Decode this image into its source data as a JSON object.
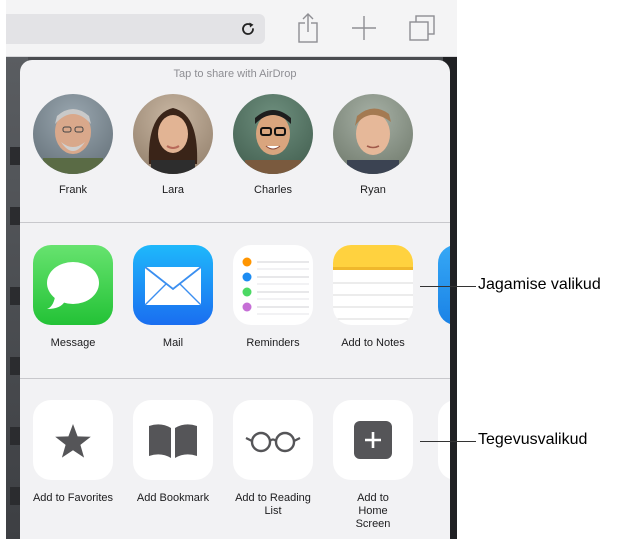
{
  "airdrop": {
    "hint": "Tap to share with AirDrop",
    "people": [
      {
        "name": "Frank"
      },
      {
        "name": "Lara"
      },
      {
        "name": "Charles"
      },
      {
        "name": "Ryan"
      }
    ]
  },
  "share_apps": [
    {
      "label": "Message",
      "icon": "message-bubble-icon",
      "color": "#4cd964"
    },
    {
      "label": "Mail",
      "icon": "mail-envelope-icon",
      "color": "#1e8af5"
    },
    {
      "label": "Reminders",
      "icon": "reminders-list-icon",
      "color": "#ffffff"
    },
    {
      "label": "Add to Notes",
      "icon": "notes-icon",
      "color": "#ffd94a"
    }
  ],
  "actions": [
    {
      "label": "Add to Favorites",
      "icon": "star-icon"
    },
    {
      "label": "Add Bookmark",
      "icon": "book-icon"
    },
    {
      "label": "Add to Reading List",
      "icon": "glasses-icon"
    },
    {
      "label": "Add to Home Screen",
      "icon": "plus-square-icon"
    }
  ],
  "callouts": {
    "share_options": "Jagamise valikud",
    "action_options": "Tegevusvalikud"
  },
  "toolbar": {
    "icons": [
      "reload-icon",
      "share-icon",
      "add-tab-icon",
      "tabs-icon"
    ]
  }
}
